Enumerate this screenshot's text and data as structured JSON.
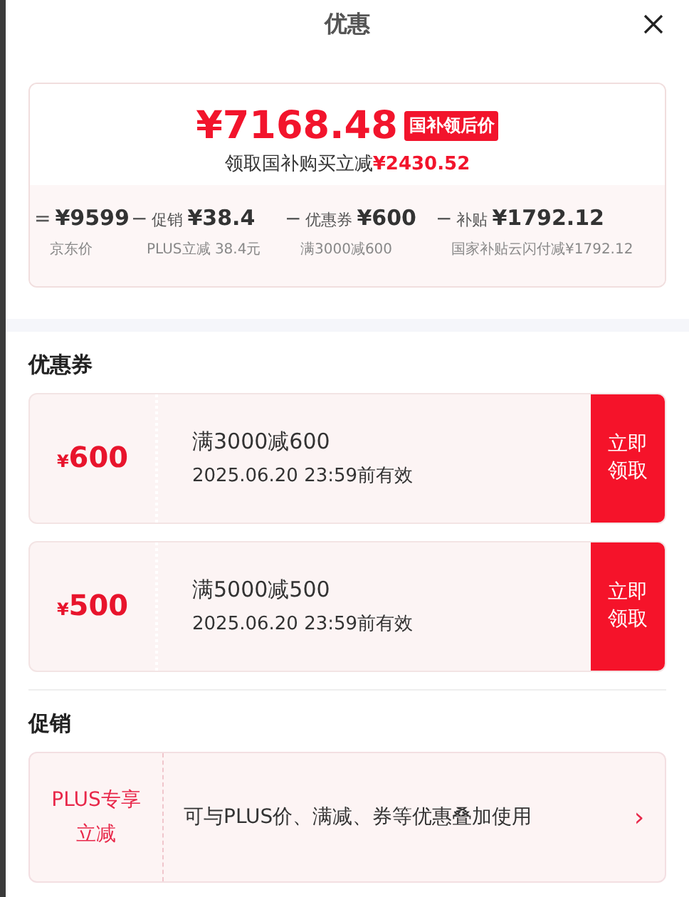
{
  "header": {
    "title": "优惠"
  },
  "summary": {
    "price": "¥7168.48",
    "price_tag": "国补领后价",
    "saving_label": "领取国补购买立减",
    "saving_amount": "¥2430.52",
    "breakdown": [
      {
        "operator": "=",
        "amount": "¥9599",
        "note": "京东价"
      },
      {
        "operator": "−",
        "label": "促销",
        "amount": "¥38.4",
        "note": "PLUS立减 38.4元"
      },
      {
        "operator": "−",
        "label": "优惠券",
        "amount": "¥600",
        "note": "满3000减600"
      },
      {
        "operator": "−",
        "label": "补贴",
        "amount": "¥1792.12",
        "note": "国家补贴云闪付减¥1792.12"
      }
    ]
  },
  "coupons": {
    "title": "优惠券",
    "items": [
      {
        "currency": "¥",
        "value": "600",
        "condition": "满3000减600",
        "validity": "2025.06.20 23:59前有效",
        "action": "立即领取"
      },
      {
        "currency": "¥",
        "value": "500",
        "condition": "满5000减500",
        "validity": "2025.06.20 23:59前有效",
        "action": "立即领取"
      }
    ]
  },
  "promotions": {
    "title": "促销",
    "items": [
      {
        "tag": "PLUS专享立减",
        "description": "可与PLUS价、满减、券等优惠叠加使用",
        "arrow": "›"
      }
    ]
  }
}
